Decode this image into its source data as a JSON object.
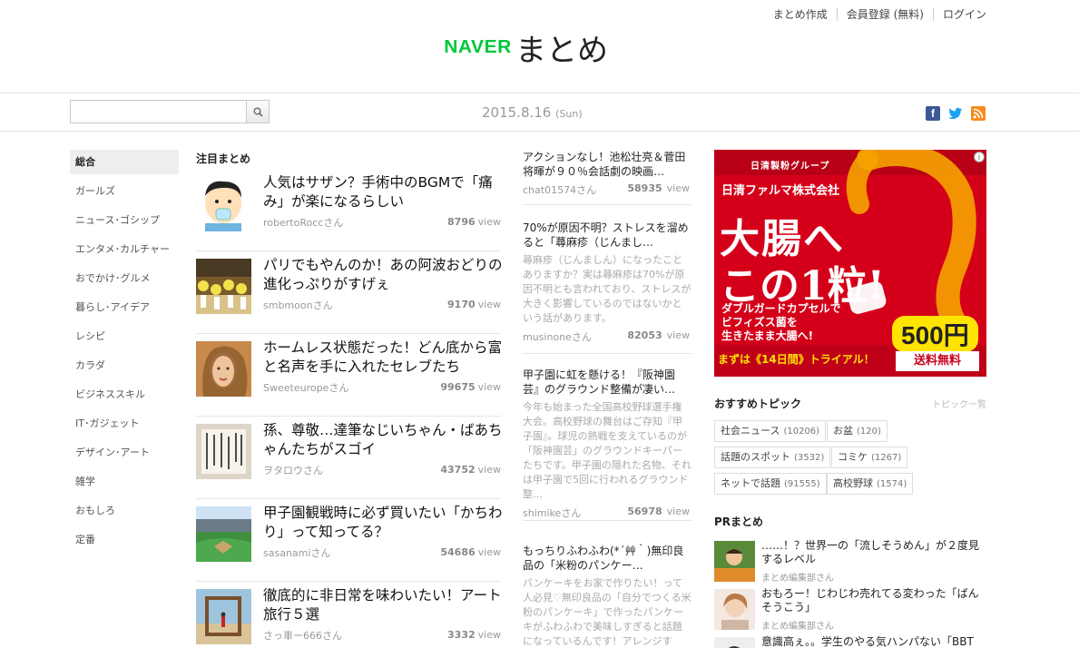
{
  "header": {
    "links": [
      "まとめ作成",
      "会員登録 (無料)",
      "ログイン"
    ],
    "logo_naver": "NAVER",
    "logo_matome": "まとめ"
  },
  "toolbar": {
    "search_placeholder": "",
    "date": "2015.8.16",
    "day": "(Sun)"
  },
  "nav": [
    "総合",
    "ガールズ",
    "ニュース･ゴシップ",
    "エンタメ･カルチャー",
    "おでかけ･グルメ",
    "暮らし･アイデア",
    "レシピ",
    "カラダ",
    "ビジネススキル",
    "IT･ガジェット",
    "デザイン･アート",
    "雑学",
    "おもしろ",
    "定番"
  ],
  "featured": {
    "title": "注目まとめ",
    "items": [
      {
        "title": "人気はサザン？手術中のBGMで「痛み」が楽になるらしい",
        "author": "robertoRoccさん",
        "views": "8796",
        "view_label": "view"
      },
      {
        "title": "パリでもやんのか！あの阿波おどりの進化っぷりがすげぇ",
        "author": "smbmoonさん",
        "views": "9170",
        "view_label": "view"
      },
      {
        "title": "ホームレス状態だった！どん底から富と名声を手に入れたセレブたち",
        "author": "Sweeteuropeさん",
        "views": "99675",
        "view_label": "view"
      },
      {
        "title": "孫、尊敬…達筆なじいちゃん・ばあちゃんたちがスゴイ",
        "author": "ヲタロウさん",
        "views": "43752",
        "view_label": "view"
      },
      {
        "title": "甲子園観戦時に必ず買いたい「かちわり」って知ってる？",
        "author": "sasanamiさん",
        "views": "54686",
        "view_label": "view"
      },
      {
        "title": "徹底的に非日常を味わいたい！アート旅行５選",
        "author": "さっ車ー666さん",
        "views": "3332",
        "view_label": "view"
      }
    ]
  },
  "middle": [
    {
      "title": "アクションなし！池松壮亮＆菅田将暉が９０％会話劇の映画…",
      "desc": "",
      "author": "chat01574さん",
      "views": "58935",
      "view_label": "view"
    },
    {
      "title": "70%が原因不明？ストレスを溜めると「蕁麻疹（じんまし…",
      "desc": "蕁麻疹（じんましん）になったことありますか？実は蕁麻疹は70%が原因不明とも言われており、ストレスが大きく影響しているのではないかという話があります。",
      "author": "musinoneさん",
      "views": "82053",
      "view_label": "view"
    },
    {
      "title": "甲子園に虹を懸ける！『阪神園芸』のグラウンド整備が凄い…",
      "desc": "今年も始まった全国高校野球選手権大会。高校野球の舞台はご存知『甲子園』。球児の熱戦を支えているのが「阪神園芸」のグラウンドキーパーたちです。甲子園の隠れた名物、それは甲子園で5回に行われるグラウンド整…",
      "author": "shimikeさん",
      "views": "56978",
      "view_label": "view"
    },
    {
      "title": "もっちりふわふわ(*´艸｀)無印良品の「米粉のパンケー…",
      "desc": "パンケーキをお家で作りたい！って人必見♡無印良品の「自分でつくる米粉のパンケーキ」で作ったパンケーキがふわふわで美味しすぎると話題になっているんです！アレンジす",
      "author": "",
      "views": "",
      "view_label": ""
    }
  ],
  "ad": {
    "group": "日清製粉グループ",
    "company": "日清ファルマ株式会社",
    "line1": "大腸へ",
    "line2": "この1粒!",
    "small": "ダブルガードカプセルで\nビフィズス菌を\n生きたまま大腸へ!",
    "price": "500円",
    "cta": "まずは《14日間》トライアル！",
    "cta2": "送料無料",
    "info": "i"
  },
  "topics": {
    "title": "おすすめトピック",
    "link": "トピック一覧",
    "tags": [
      {
        "label": "社会ニュース",
        "count": "(10206)"
      },
      {
        "label": "お盆",
        "count": "(120)"
      },
      {
        "label": "話題のスポット",
        "count": "(3532)"
      },
      {
        "label": "コミケ",
        "count": "(1267)"
      },
      {
        "label": "ネットで話題",
        "count": "(91555)"
      },
      {
        "label": "高校野球",
        "count": "(1574)"
      }
    ]
  },
  "pr": {
    "title": "PRまとめ",
    "items": [
      {
        "title": "……！？世界一の「流しそうめん」が２度見するレベル",
        "author": "まとめ編集部さん"
      },
      {
        "title": "おもろー！じわじわ売れてる変わった「ばんそうこう」",
        "author": "まとめ編集部さん"
      },
      {
        "title": "意識高ぇ。。学生のやる気ハンパない「BBT",
        "author": ""
      }
    ]
  },
  "colors": {
    "brand": "#00c73c",
    "ad_red": "#c8001c",
    "ad_yellow": "#ffe400"
  }
}
